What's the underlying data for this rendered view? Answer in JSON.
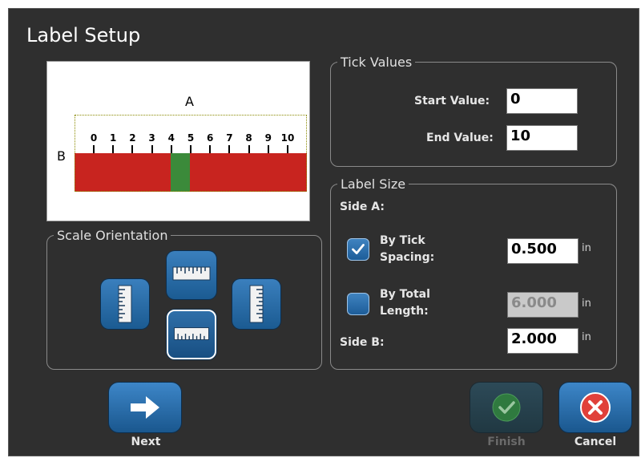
{
  "window": {
    "title": "Label Setup"
  },
  "preview": {
    "side_a": "A",
    "side_b": "B",
    "ticks": [
      "0",
      "1",
      "2",
      "3",
      "4",
      "5",
      "6",
      "7",
      "8",
      "9",
      "10"
    ]
  },
  "tick_values": {
    "legend": "Tick Values",
    "start_label": "Start Value:",
    "start_value": "0",
    "end_label": "End Value:",
    "end_value": "10"
  },
  "label_size": {
    "legend": "Label Size",
    "side_a_label": "Side A:",
    "by_tick_label_line1": "By Tick",
    "by_tick_label_line2": "Spacing:",
    "by_tick_checked": true,
    "by_tick_value": "0.500",
    "by_total_label_line1": "By Total",
    "by_total_label_line2": "Length:",
    "by_total_checked": false,
    "by_total_value": "6.000",
    "side_b_label": "Side B:",
    "side_b_value": "2.000",
    "unit": "in"
  },
  "scale_orientation": {
    "legend": "Scale Orientation",
    "options": [
      "left-vertical",
      "top-horizontal",
      "bottom-horizontal",
      "right-vertical"
    ],
    "selected": "bottom-horizontal"
  },
  "footer": {
    "next_label": "Next",
    "finish_label": "Finish",
    "cancel_label": "Cancel"
  },
  "colors": {
    "scale_bar": "#c8241f",
    "scale_highlight": "#3b8a3a",
    "button_blue": "#2f73b2",
    "cancel_red": "#e0403a",
    "finish_green": "#3a9a4a"
  }
}
